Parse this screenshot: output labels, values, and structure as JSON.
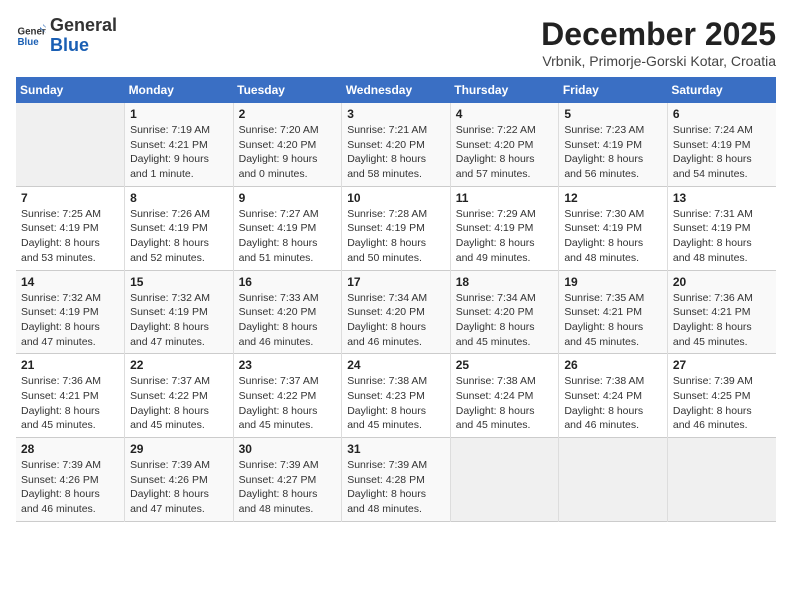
{
  "logo": {
    "general": "General",
    "blue": "Blue"
  },
  "header": {
    "title": "December 2025",
    "location": "Vrbnik, Primorje-Gorski Kotar, Croatia"
  },
  "weekdays": [
    "Sunday",
    "Monday",
    "Tuesday",
    "Wednesday",
    "Thursday",
    "Friday",
    "Saturday"
  ],
  "weeks": [
    [
      {
        "day": "",
        "info": ""
      },
      {
        "day": "1",
        "info": "Sunrise: 7:19 AM\nSunset: 4:21 PM\nDaylight: 9 hours\nand 1 minute."
      },
      {
        "day": "2",
        "info": "Sunrise: 7:20 AM\nSunset: 4:20 PM\nDaylight: 9 hours\nand 0 minutes."
      },
      {
        "day": "3",
        "info": "Sunrise: 7:21 AM\nSunset: 4:20 PM\nDaylight: 8 hours\nand 58 minutes."
      },
      {
        "day": "4",
        "info": "Sunrise: 7:22 AM\nSunset: 4:20 PM\nDaylight: 8 hours\nand 57 minutes."
      },
      {
        "day": "5",
        "info": "Sunrise: 7:23 AM\nSunset: 4:19 PM\nDaylight: 8 hours\nand 56 minutes."
      },
      {
        "day": "6",
        "info": "Sunrise: 7:24 AM\nSunset: 4:19 PM\nDaylight: 8 hours\nand 54 minutes."
      }
    ],
    [
      {
        "day": "7",
        "info": "Sunrise: 7:25 AM\nSunset: 4:19 PM\nDaylight: 8 hours\nand 53 minutes."
      },
      {
        "day": "8",
        "info": "Sunrise: 7:26 AM\nSunset: 4:19 PM\nDaylight: 8 hours\nand 52 minutes."
      },
      {
        "day": "9",
        "info": "Sunrise: 7:27 AM\nSunset: 4:19 PM\nDaylight: 8 hours\nand 51 minutes."
      },
      {
        "day": "10",
        "info": "Sunrise: 7:28 AM\nSunset: 4:19 PM\nDaylight: 8 hours\nand 50 minutes."
      },
      {
        "day": "11",
        "info": "Sunrise: 7:29 AM\nSunset: 4:19 PM\nDaylight: 8 hours\nand 49 minutes."
      },
      {
        "day": "12",
        "info": "Sunrise: 7:30 AM\nSunset: 4:19 PM\nDaylight: 8 hours\nand 48 minutes."
      },
      {
        "day": "13",
        "info": "Sunrise: 7:31 AM\nSunset: 4:19 PM\nDaylight: 8 hours\nand 48 minutes."
      }
    ],
    [
      {
        "day": "14",
        "info": "Sunrise: 7:32 AM\nSunset: 4:19 PM\nDaylight: 8 hours\nand 47 minutes."
      },
      {
        "day": "15",
        "info": "Sunrise: 7:32 AM\nSunset: 4:19 PM\nDaylight: 8 hours\nand 47 minutes."
      },
      {
        "day": "16",
        "info": "Sunrise: 7:33 AM\nSunset: 4:20 PM\nDaylight: 8 hours\nand 46 minutes."
      },
      {
        "day": "17",
        "info": "Sunrise: 7:34 AM\nSunset: 4:20 PM\nDaylight: 8 hours\nand 46 minutes."
      },
      {
        "day": "18",
        "info": "Sunrise: 7:34 AM\nSunset: 4:20 PM\nDaylight: 8 hours\nand 45 minutes."
      },
      {
        "day": "19",
        "info": "Sunrise: 7:35 AM\nSunset: 4:21 PM\nDaylight: 8 hours\nand 45 minutes."
      },
      {
        "day": "20",
        "info": "Sunrise: 7:36 AM\nSunset: 4:21 PM\nDaylight: 8 hours\nand 45 minutes."
      }
    ],
    [
      {
        "day": "21",
        "info": "Sunrise: 7:36 AM\nSunset: 4:21 PM\nDaylight: 8 hours\nand 45 minutes."
      },
      {
        "day": "22",
        "info": "Sunrise: 7:37 AM\nSunset: 4:22 PM\nDaylight: 8 hours\nand 45 minutes."
      },
      {
        "day": "23",
        "info": "Sunrise: 7:37 AM\nSunset: 4:22 PM\nDaylight: 8 hours\nand 45 minutes."
      },
      {
        "day": "24",
        "info": "Sunrise: 7:38 AM\nSunset: 4:23 PM\nDaylight: 8 hours\nand 45 minutes."
      },
      {
        "day": "25",
        "info": "Sunrise: 7:38 AM\nSunset: 4:24 PM\nDaylight: 8 hours\nand 45 minutes."
      },
      {
        "day": "26",
        "info": "Sunrise: 7:38 AM\nSunset: 4:24 PM\nDaylight: 8 hours\nand 46 minutes."
      },
      {
        "day": "27",
        "info": "Sunrise: 7:39 AM\nSunset: 4:25 PM\nDaylight: 8 hours\nand 46 minutes."
      }
    ],
    [
      {
        "day": "28",
        "info": "Sunrise: 7:39 AM\nSunset: 4:26 PM\nDaylight: 8 hours\nand 46 minutes."
      },
      {
        "day": "29",
        "info": "Sunrise: 7:39 AM\nSunset: 4:26 PM\nDaylight: 8 hours\nand 47 minutes."
      },
      {
        "day": "30",
        "info": "Sunrise: 7:39 AM\nSunset: 4:27 PM\nDaylight: 8 hours\nand 48 minutes."
      },
      {
        "day": "31",
        "info": "Sunrise: 7:39 AM\nSunset: 4:28 PM\nDaylight: 8 hours\nand 48 minutes."
      },
      {
        "day": "",
        "info": ""
      },
      {
        "day": "",
        "info": ""
      },
      {
        "day": "",
        "info": ""
      }
    ]
  ]
}
